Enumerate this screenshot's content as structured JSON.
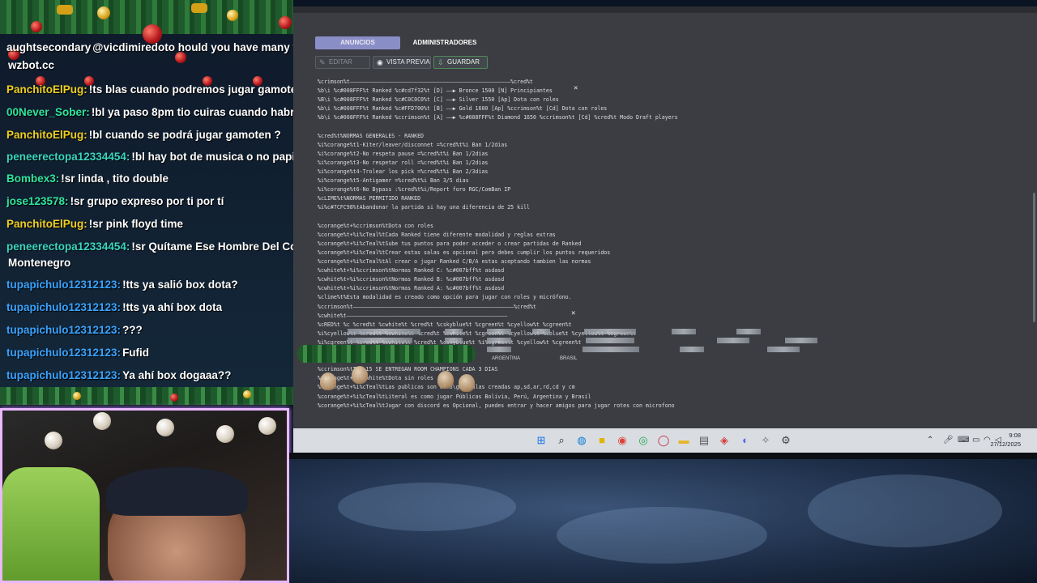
{
  "chat": {
    "messages": [
      {
        "user": "aughtsecondary",
        "text": "@vicdimiredoto hould you have many vi",
        "color": "#ffffff"
      },
      {
        "user": "",
        "text": "wzbot.cc",
        "color": "#ffffff"
      },
      {
        "user": "PanchitoElPug:",
        "text": "!ts blas cuando podremos jugar gamoten ?",
        "color": "#f0d020"
      },
      {
        "user": "00Never_Sober:",
        "text": "!bl ya paso 8pm tio cuiras cuando habre vox",
        "color": "#2ee59d"
      },
      {
        "user": "PanchitoElPug:",
        "text": "!bl cuando se podrá jugar gamoten ?",
        "color": "#f0d020"
      },
      {
        "user": "peneerectopa12334454:",
        "text": "!bl hay bot de musica o no papi bolo",
        "color": "#3ad6c0"
      },
      {
        "user": "Bombex3:",
        "text": "!sr linda , tito double",
        "color": "#2ee59d"
      },
      {
        "user": "jose123578:",
        "text": "!sr grupo expreso por ti por tí",
        "color": "#2ee59d"
      },
      {
        "user": "PanchitoElPug:",
        "text": "!sr pink floyd time",
        "color": "#f0d020"
      },
      {
        "user": "peneerectopa12334454:",
        "text": "!sr Quítame Ese Hombre Del Corazón",
        "color": "#3ad6c0"
      },
      {
        "user": "",
        "text": "Montenegro",
        "color": "#ffffff"
      },
      {
        "user": "tupapichulo12312123:",
        "text": "!tts ya salió box dota?",
        "color": "#3aa3ff"
      },
      {
        "user": "tupapichulo12312123:",
        "text": "!tts ya ahí box dota",
        "color": "#3aa3ff"
      },
      {
        "user": "tupapichulo12312123:",
        "text": "???",
        "color": "#3aa3ff"
      },
      {
        "user": "tupapichulo12312123:",
        "text": "Fufid",
        "color": "#3aa3ff"
      },
      {
        "user": "tupapichulo12312123:",
        "text": "Ya ahí box dogaaa??",
        "color": "#3aa3ff"
      }
    ]
  },
  "app": {
    "tabs": {
      "anuncios": "ANUNCIOS",
      "admin": "ADMINISTRADORES"
    },
    "toolbar": {
      "editar": "EDITAR",
      "vista": "VISTA PREVIA",
      "guardar": "GUARDAR"
    },
    "editor_lines": [
      "%crimson%t——————————————————————————————————————————————————%cred%t",
      "%b\\i %c#008FFF%t Ranked %c#cd7f32%t [D] ——▶ Bronce     1500 [N] Principiantes",
      "%B\\i %c#008FFF%t Ranked %c#C0C0C0%t [C] ——▶ Silver     1550 [Ap] Dota con roles",
      "%b\\i %c#008FFF%t Ranked %c#FFD700%t [B] ——▶ Gold      1600 [Ap] %ccrimson%t [Cd] Dota con roles",
      "%b\\i %c#008FFF%t Ranked %ccrimson%t [A] ——▶ %c#008FFF%t Diamond   1650 %ccrimson%t [Cd] %cred%t Modo Draft players",
      "",
      "%cred%t%NORMAS GENERALES - RANKED",
      "%i%corange%t1-Kiter/leaver/disconnet =%cred%t%i Ban 1/2dias",
      "%i%corange%t2-No respeta pause =%cred%t%i Ban 1/2dias",
      "%i%corange%t3-No respetar roll =%cred%t%i Ban 1/2dias",
      "%i%corange%t4-Trolear los pick =%cred%t%i Ban 2/3dias",
      "%i%corange%t5-Antigamer =%cred%t%i Ban 3/5 dias",
      "%i%corange%t6-No Bypass :%cred%t%i/Report foro RGC/ComBan IP",
      "%cLIME%t%NORMAS PERMITIDO RANKED",
      "%i%c#7CFC98%tAbandonar la partida si hay una diferencia de 25 kill",
      "",
      "%corange%t+%ccrimson%tDota con roles",
      "%corange%t+%i%cTeal%tCada Ranked tiene diferente modalidad y reglas extras",
      "%corange%t+%i%cTeal%tSube tus puntos para poder acceder o crear partidas de Ranked",
      "%corange%t+%i%cTeal%tCrear estas salas es opcional pero debes cumplir los puntos requeridos",
      "%corange%t+%i%cTeal%tAl crear o jugar Ranked C/B/A estas aceptando tambien las normas",
      "%cwhite%t+%i%ccrimson%tNormas Ranked C: %c#007bff%t asdasd",
      "%cwhite%t+%i%ccrimson%tNormas Ranked B: %c#007bff%t asdasd",
      "%cwhite%t+%i%ccrimson%tNormas Ranked A: %c#007bff%t asdasd",
      "%clime%t%Esta modalidad es creado como opción para jugar con roles y micrófono.",
      "%ccrimson%t——————————————————————————————————————————————————%cred%t",
      "%cwhite%t——————————————————————————————————————————————————",
      " %cRED%t  %c         %cred%t      %cwhite%t      %cred%t      %cskyblue%t          %cgreen%t      %cyellow%t   %cgreen%t",
      " %i%cyellow%t        %cred%t      %cwhite%t      %cred%t      %cwhite%t          %cgreen%t   %cyellow%t   %cblue%t   %cyellow%t   %cgreen%t",
      " %i%cgreen%t        %cred%t      %cwhite%t      %cred%t      %cskyblue%t          %i%cgreen%t      %cyellow%t   %cgreen%t",
      "",
      "",
      "%ccrimson%tTOP 15 SE ENTREGAN ROOM CHAMPIONS CADA 3 DIAS",
      "%corange%t+%i%cwhite%tDota sin roles",
      "%corange%t+%i%cTeal%tLas publicas son el 5\\gn, salas creadas ap,sd,ar,rd,cd y cm",
      "%corange%t+%i%cTeal%tLiteral es como jugar Públicas Bolivia, Perú, Argentina y Brasil",
      "%corange%t+%i%cTeal%tJugar con discord es Opcional, puedes entrar y hacer amigos para jugar rotes con microfono"
    ],
    "flag_labels": {
      "argentina": "ARGENTINA",
      "brasil": "BRASIL"
    }
  },
  "taskbar": {
    "time": "9:08",
    "date": "27/12/2025"
  },
  "colors": {
    "tab_active": "#8a8ec7",
    "window_bg": "#3b3d42",
    "webcam_border": "#e9b8ff"
  }
}
